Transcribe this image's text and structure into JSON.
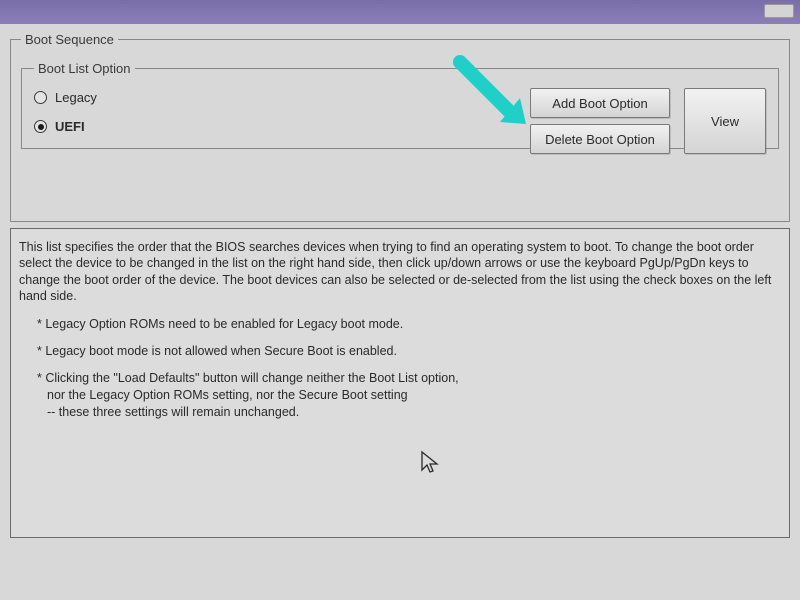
{
  "titlebar": {},
  "bootSequence": {
    "legend": "Boot Sequence",
    "bootListOption": {
      "legend": "Boot List Option",
      "options": {
        "legacy": "Legacy",
        "uefi": "UEFI"
      },
      "buttons": {
        "add": "Add Boot Option",
        "delete": "Delete Boot Option",
        "view": "View"
      }
    }
  },
  "info": {
    "paragraph": "This list specifies the order that the BIOS searches devices when trying to find an operating system to boot. To change the boot order select the device to be changed in the list on the right hand side, then click up/down arrows or use the keyboard PgUp/PgDn keys to change the boot order of the device. The boot devices can also be selected or de-selected from the list using the check boxes on the left hand side.",
    "bullet1": "* Legacy Option ROMs need to be enabled for Legacy boot mode.",
    "bullet2": "* Legacy boot mode is not allowed when Secure Boot is enabled.",
    "bullet3_line1": "* Clicking the \"Load Defaults\" button will change neither the Boot List option,",
    "bullet3_line2": "nor the Legacy Option ROMs setting, nor the Secure Boot setting",
    "bullet3_line3": "-- these three settings will remain unchanged."
  },
  "colors": {
    "arrow": "#1fd0c8"
  }
}
